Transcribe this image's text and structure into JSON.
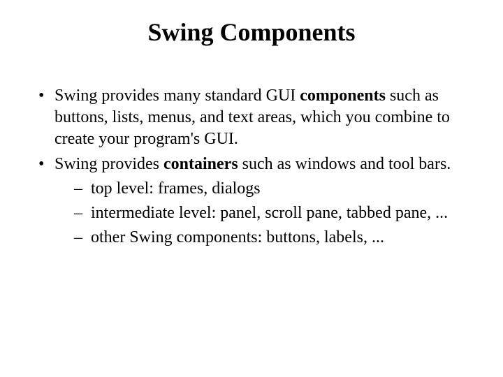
{
  "title": "Swing Components",
  "bullet1_a": "Swing provides many standard GUI ",
  "bullet1_bold": "components",
  "bullet1_b": " such as buttons, lists, menus, and text areas, which you combine to create your program's GUI.",
  "bullet2_a": "Swing provides ",
  "bullet2_bold": "containers",
  "bullet2_b": " such as windows and tool bars.",
  "sub1": "top level: frames, dialogs",
  "sub2": "intermediate level: panel, scroll pane, tabbed pane, ...",
  "sub3": "other Swing components: buttons, labels, ..."
}
